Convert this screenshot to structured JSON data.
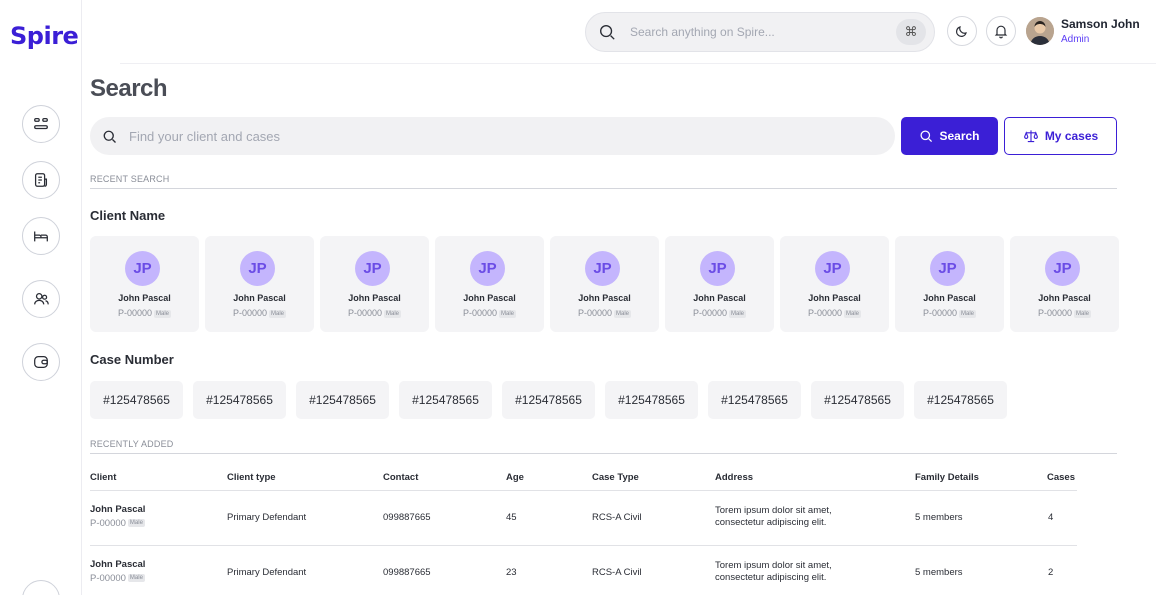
{
  "app": {
    "logo": "Spire"
  },
  "topbar": {
    "search_placeholder": "Search anything on Spire...",
    "shortcut": "⌘",
    "user": {
      "name": "Samson John",
      "role": "Admin"
    }
  },
  "page": {
    "title": "Search",
    "search_placeholder": "Find your client and cases",
    "search_button": "Search",
    "mycases_button": "My cases",
    "recent_search_label": "RECENT SEARCH",
    "client_name_title": "Client Name",
    "case_number_title": "Case Number",
    "recently_added_label": "RECENTLY ADDED"
  },
  "clients": [
    {
      "initials": "JP",
      "name": "John Pascal",
      "id": "P-00000",
      "gender": "Male"
    },
    {
      "initials": "JP",
      "name": "John Pascal",
      "id": "P-00000",
      "gender": "Male"
    },
    {
      "initials": "JP",
      "name": "John Pascal",
      "id": "P-00000",
      "gender": "Male"
    },
    {
      "initials": "JP",
      "name": "John Pascal",
      "id": "P-00000",
      "gender": "Male"
    },
    {
      "initials": "JP",
      "name": "John Pascal",
      "id": "P-00000",
      "gender": "Male"
    },
    {
      "initials": "JP",
      "name": "John Pascal",
      "id": "P-00000",
      "gender": "Male"
    },
    {
      "initials": "JP",
      "name": "John Pascal",
      "id": "P-00000",
      "gender": "Male"
    },
    {
      "initials": "JP",
      "name": "John Pascal",
      "id": "P-00000",
      "gender": "Male"
    },
    {
      "initials": "JP",
      "name": "John Pascal",
      "id": "P-00000",
      "gender": "Male"
    }
  ],
  "cases": [
    "#125478565",
    "#125478565",
    "#125478565",
    "#125478565",
    "#125478565",
    "#125478565",
    "#125478565",
    "#125478565",
    "#125478565"
  ],
  "table": {
    "headers": [
      "Client",
      "Client type",
      "Contact",
      "Age",
      "Case Type",
      "Address",
      "Family Details",
      "Cases"
    ],
    "rows": [
      {
        "name": "John Pascal",
        "id": "P-00000",
        "gender": "Male",
        "type": "Primary Defendant",
        "contact": "099887665",
        "age": "45",
        "case_type": "RCS-A Civil",
        "address_1": "Torem ipsum dolor sit amet,",
        "address_2": "consectetur adipiscing elit.",
        "family": "5 members",
        "cases": "4"
      },
      {
        "name": "John Pascal",
        "id": "P-00000",
        "gender": "Male",
        "type": "Primary Defendant",
        "contact": "099887665",
        "age": "23",
        "case_type": "RCS-A Civil",
        "address_1": "Torem ipsum dolor sit amet,",
        "address_2": "consectetur adipiscing elit.",
        "family": "5 members",
        "cases": "2"
      }
    ]
  },
  "colors": {
    "accent": "#3b1fd6",
    "avatar_bg": "#c4b5fd",
    "avatar_text": "#6b4ce6"
  },
  "icons": {
    "sidebar": [
      "dashboard-icon",
      "document-icon",
      "bed-icon",
      "users-icon",
      "wallet-icon",
      "chevron-left-icon"
    ],
    "topbar": [
      "search-icon",
      "moon-icon",
      "bell-icon"
    ]
  }
}
